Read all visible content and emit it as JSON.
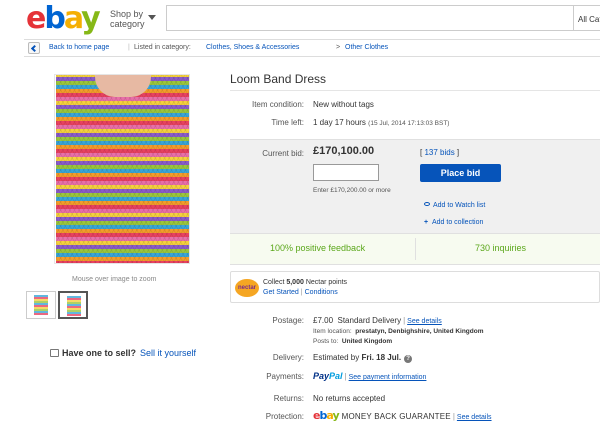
{
  "header": {
    "logo": {
      "e": "e",
      "b": "b",
      "a": "a",
      "y": "y"
    },
    "shop_by": "Shop by",
    "category": "category",
    "search_value": "",
    "search_category": "All Cat"
  },
  "breadcrumb": {
    "back": "Back to home page",
    "listed": "Listed in category:",
    "cat1": "Clothes, Shoes & Accessories",
    "arrow": ">",
    "cat2": "Other Clothes"
  },
  "gallery": {
    "mouse_over": "Mouse over image to zoom"
  },
  "sell": {
    "question": "Have one to sell?",
    "link": "Sell it yourself"
  },
  "item": {
    "title": "Loom Band Dress",
    "condition_label": "Item condition:",
    "condition": "New without tags",
    "time_left_label": "Time left:",
    "time_left": "1 day 17 hours",
    "end_time": "(15 Jul, 2014  17:13:03 BST)"
  },
  "bid": {
    "label": "Current bid:",
    "price": "£170,100.00",
    "bids_link": "137 bids",
    "input_value": "",
    "enter_text": "Enter £170,200.00 or more",
    "place_bid": "Place bid",
    "watch": "Add to Watch list",
    "collection": "Add to collection"
  },
  "stats": {
    "feedback": "100% positive feedback",
    "inquiries": "730 inquiries"
  },
  "nectar": {
    "badge": "nectar",
    "collect_prefix": "Collect ",
    "points": "5,000",
    "collect_suffix": " Nectar points",
    "get_started": "Get Started",
    "conditions": "Conditions"
  },
  "shipping": {
    "postage_label": "Postage:",
    "postage": "£7.00",
    "service": "Standard Delivery",
    "see_details": "See details",
    "location_label": "Item location:",
    "location": "prestatyn, Denbighshire, United Kingdom",
    "posts_label": "Posts to:",
    "posts": "United Kingdom",
    "delivery_label": "Delivery:",
    "delivery_prefix": "Estimated by",
    "delivery_date": "Fri. 18 Jul.",
    "payments_label": "Payments:",
    "paypal_1": "Pay",
    "paypal_2": "Pal",
    "see_payment": "See payment information",
    "returns_label": "Returns:",
    "returns": "No returns accepted",
    "protection_label": "Protection:",
    "mbg": "MONEY BACK GUARANTEE",
    "see_details_2": "See details"
  },
  "colors": {
    "link": "#0654ba",
    "place_bid_bg": "#0654ba",
    "feedback_green": "#5ba71b"
  }
}
